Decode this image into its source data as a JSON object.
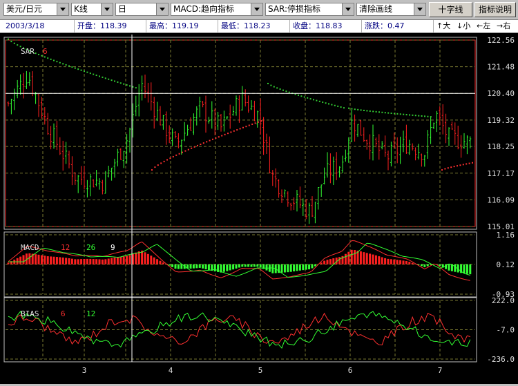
{
  "toolbar": {
    "currency_select": "美元/日元",
    "chart_type_select": "K线",
    "period_select": "日",
    "indicator1_select": "MACD:趋向指标",
    "indicator2_select": "SAR:停损指标",
    "clear_select": "清除画线",
    "crosshair_button": "十字线",
    "help_button": "指标说明"
  },
  "info": {
    "date": "2003/3/18",
    "open": "开盘：118.39",
    "high": "最高：119.19",
    "low": "最低：118.23",
    "close": "收盘：118.83",
    "change": "涨跌：0.47",
    "nav_up": "↑大",
    "nav_down": "↓小",
    "nav_left": "←左",
    "nav_right": "→右"
  },
  "colors": {
    "up": "#33ff33",
    "down": "#ff2020",
    "sar": "#33cc33",
    "sar_low": "#ff3030",
    "grid": "#7a7a30",
    "frame": "#c0c0c0",
    "label": "#e0e0e0"
  },
  "chart_data": [
    {
      "type": "candlestick",
      "indicator_label": "SAR",
      "indicator_param": "6",
      "y_ticks": [
        "122.56",
        "121.48",
        "120.40",
        "119.32",
        "118.25",
        "117.17",
        "116.09",
        "115.01"
      ],
      "ylim": [
        115.01,
        122.56
      ],
      "x_labels": [
        "3",
        "4",
        "5",
        "6",
        "7"
      ],
      "crosshair_price": 120.4
    },
    {
      "type": "bar+line",
      "indicator_label": "MACD",
      "params": [
        "12",
        "26",
        "9"
      ],
      "y_ticks": [
        "1.16",
        "0.12",
        "-0.93"
      ],
      "ylim": [
        -0.93,
        1.16
      ]
    },
    {
      "type": "line",
      "indicator_label": "BIAS",
      "params": [
        "6",
        "12"
      ],
      "y_ticks": [
        "222.0",
        "-7.0",
        "-236.0"
      ],
      "ylim": [
        -236.0,
        222.0
      ]
    }
  ]
}
